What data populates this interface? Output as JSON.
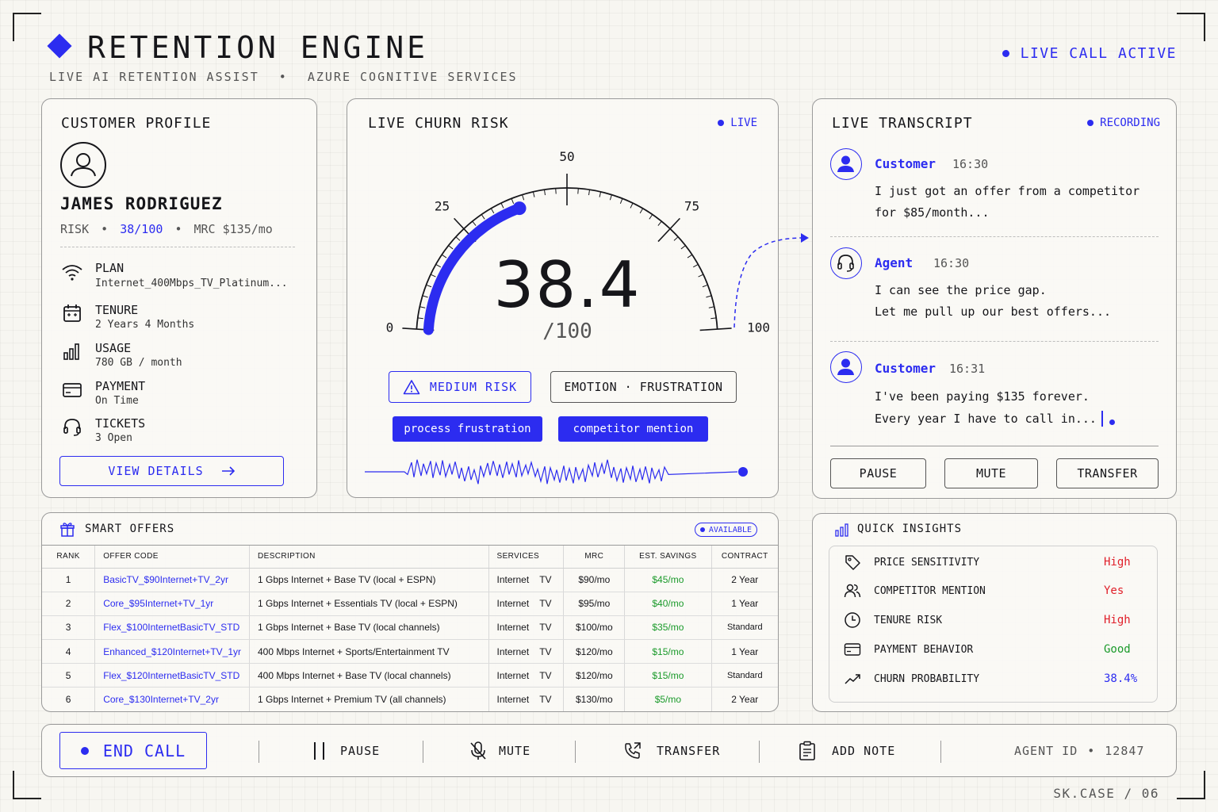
{
  "header": {
    "title": "RETENTION ENGINE",
    "subtitle_left": "LIVE AI RETENTION ASSIST",
    "subtitle_sep": "•",
    "subtitle_right": "AZURE COGNITIVE SERVICES",
    "status": "LIVE CALL ACTIVE"
  },
  "profile": {
    "title": "CUSTOMER PROFILE",
    "name": "JAMES RODRIGUEZ",
    "risk_label": "RISK",
    "risk_value": "38/100",
    "mrc": "MRC $135/mo",
    "sep": "•",
    "items": [
      {
        "icon": "wifi-icon",
        "label": "PLAN",
        "value": "Internet_400Mbps_TV_Platinum..."
      },
      {
        "icon": "calendar-icon",
        "label": "TENURE",
        "value": "2 Years 4 Months"
      },
      {
        "icon": "bar-chart-icon",
        "label": "USAGE",
        "value": "780 GB / month"
      },
      {
        "icon": "credit-card-icon",
        "label": "PAYMENT",
        "value": "On Time"
      },
      {
        "icon": "headset-icon",
        "label": "TICKETS",
        "value": "3 Open"
      }
    ],
    "view_details": "VIEW DETAILS"
  },
  "churn": {
    "title": "LIVE CHURN RISK",
    "live": "LIVE",
    "score": "38.4",
    "score_max": "/100",
    "value": 38.4,
    "ticks": [
      "0",
      "25",
      "50",
      "75",
      "100"
    ],
    "risk_badge": "MEDIUM RISK",
    "emotion": "EMOTION · FRUSTRATION",
    "tags": [
      "process frustration",
      "competitor mention"
    ]
  },
  "transcript": {
    "title": "LIVE TRANSCRIPT",
    "recording": "RECORDING",
    "messages": [
      {
        "speaker": "Customer",
        "time": "16:30",
        "line1": "I just got an offer from a competitor",
        "line2": "for $85/month..."
      },
      {
        "speaker": "Agent",
        "time": "16:30",
        "line1": "I can see the price gap.",
        "line2": "Let me pull up our best offers..."
      },
      {
        "speaker": "Customer",
        "time": "16:31",
        "line1": "I've been paying $135 forever.",
        "line2": "Every year I have to call in..."
      }
    ],
    "buttons": {
      "pause": "PAUSE",
      "mute": "MUTE",
      "transfer": "TRANSFER"
    }
  },
  "offers": {
    "title": "SMART OFFERS",
    "available": "AVAILABLE",
    "columns": [
      "RANK",
      "OFFER CODE",
      "DESCRIPTION",
      "SERVICES",
      "MRC",
      "EST. SAVINGS",
      "CONTRACT"
    ],
    "rows": [
      {
        "rank": "1",
        "code": "BasicTV_$90Internet+TV_2yr",
        "desc": "1 Gbps Internet + Base TV (local + ESPN)",
        "s1": "Internet",
        "s2": "TV",
        "mrc": "$90/mo",
        "save": "$45/mo",
        "contract": "2 Year"
      },
      {
        "rank": "2",
        "code": "Core_$95Internet+TV_1yr",
        "desc": "1 Gbps Internet + Essentials TV (local + ESPN)",
        "s1": "Internet",
        "s2": "TV",
        "mrc": "$95/mo",
        "save": "$40/mo",
        "contract": "1 Year"
      },
      {
        "rank": "3",
        "code": "Flex_$100InternetBasicTV_STD",
        "desc": "1 Gbps Internet + Base TV (local channels)",
        "s1": "Internet",
        "s2": "TV",
        "mrc": "$100/mo",
        "save": "$35/mo",
        "contract": "Standard"
      },
      {
        "rank": "4",
        "code": "Enhanced_$120Internet+TV_1yr",
        "desc": "400 Mbps Internet + Sports/Entertainment TV",
        "s1": "Internet",
        "s2": "TV",
        "mrc": "$120/mo",
        "save": "$15/mo",
        "contract": "1 Year"
      },
      {
        "rank": "5",
        "code": "Flex_$120InternetBasicTV_STD",
        "desc": "400 Mbps Internet + Base TV (local channels)",
        "s1": "Internet",
        "s2": "TV",
        "mrc": "$120/mo",
        "save": "$15/mo",
        "contract": "Standard"
      },
      {
        "rank": "6",
        "code": "Core_$130Internet+TV_2yr",
        "desc": "1 Gbps Internet + Premium TV (all channels)",
        "s1": "Internet",
        "s2": "TV",
        "mrc": "$130/mo",
        "save": "$5/mo",
        "contract": "2 Year"
      }
    ]
  },
  "insights": {
    "title": "QUICK INSIGHTS",
    "items": [
      {
        "icon": "tag-icon",
        "label": "PRICE SENSITIVITY",
        "value": "High",
        "color": "#e0202a"
      },
      {
        "icon": "users-icon",
        "label": "COMPETITOR MENTION",
        "value": "Yes",
        "color": "#e0202a"
      },
      {
        "icon": "clock-icon",
        "label": "TENURE RISK",
        "value": "High",
        "color": "#e0202a"
      },
      {
        "icon": "credit-card-icon",
        "label": "PAYMENT BEHAVIOR",
        "value": "Good",
        "color": "#1a9a2a"
      },
      {
        "icon": "trend-icon",
        "label": "CHURN PROBABILITY",
        "value": "38.4%",
        "color": "#2c2cf0"
      }
    ]
  },
  "bottom": {
    "end_call": "END CALL",
    "pause": "PAUSE",
    "mute": "MUTE",
    "transfer": "TRANSFER",
    "add_note": "ADD NOTE",
    "agent_label": "AGENT ID",
    "agent_sep": "•",
    "agent_id": "12847"
  },
  "footer": "SK.CASE / 06",
  "colors": {
    "accent": "#2c2cf0",
    "danger": "#e0202a",
    "success": "#1a9a2a"
  }
}
